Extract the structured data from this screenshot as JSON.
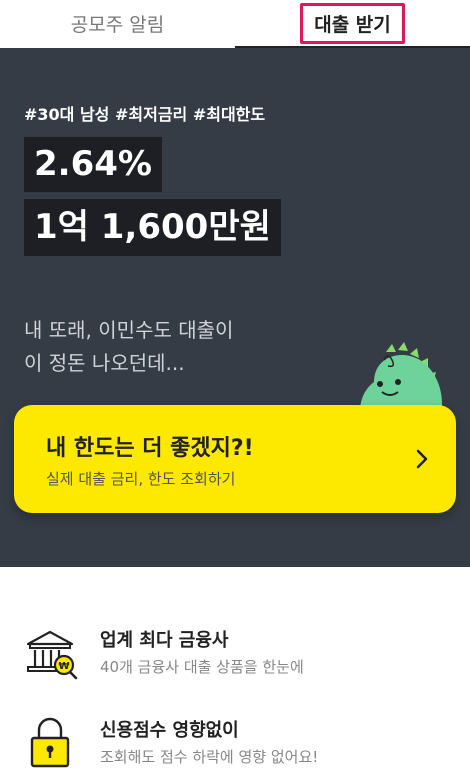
{
  "tabs": [
    {
      "label": "공모주 알림",
      "active": false
    },
    {
      "label": "대출 받기",
      "active": true
    }
  ],
  "hero": {
    "tags": "#30대 남성 #최저금리 #최대한도",
    "rate": "2.64%",
    "amount": "1억 1,600만원",
    "subtext_line1": "내 또래, 이민수도 대출이",
    "subtext_line2": "이 정돈 나오던데..."
  },
  "cta": {
    "title": "내 한도는 더 좋겠지?!",
    "subtitle": "실제 대출 금리, 한도 조회하기",
    "icon": "chevron-right-icon"
  },
  "features": [
    {
      "icon": "bank-icon",
      "title": "업계 최다 금융사",
      "desc": "40개 금융사 대출 상품을 한눈에"
    },
    {
      "icon": "lock-icon",
      "title": "신용점수 영향없이",
      "desc": "조회해도 점수 하락에 영향 없어요!"
    }
  ],
  "colors": {
    "hero_bg": "#353c46",
    "cta_bg": "#fde800",
    "highlight_bg": "#1d1f24",
    "tab_outline": "#e0175b",
    "mascot_green": "#6ed39a"
  }
}
